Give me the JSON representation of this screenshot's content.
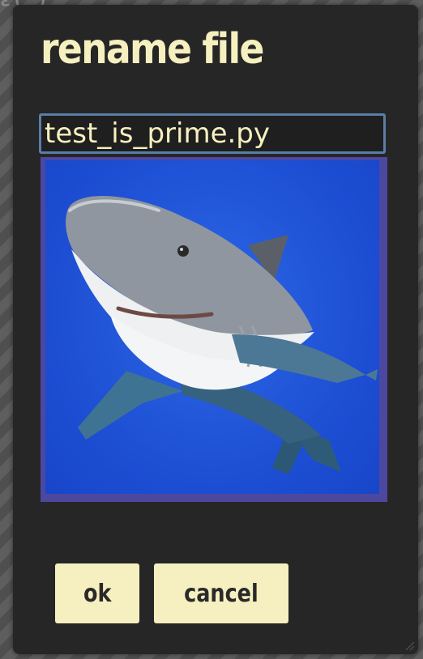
{
  "background": {
    "fragment_text": "ε( )   "
  },
  "dialog": {
    "title": "rename file",
    "filename_input": {
      "value": "test_is_prime.py"
    },
    "preview": {
      "icon": "shark-image"
    },
    "buttons": {
      "ok_label": "ok",
      "cancel_label": "cancel"
    }
  },
  "colors": {
    "accent": "#f6efbf",
    "dialog_bg": "#262626",
    "input_border": "#5a7ea6",
    "preview_frame": "#4c48a0",
    "preview_bg": "#1f53d6"
  }
}
